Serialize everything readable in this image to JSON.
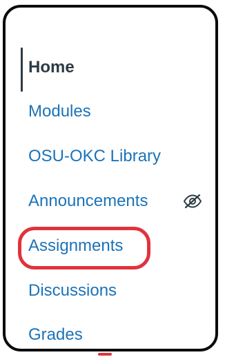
{
  "course_nav": {
    "items": [
      {
        "label": "Home",
        "active": true
      },
      {
        "label": "Modules",
        "active": false
      },
      {
        "label": "OSU-OKC Library",
        "active": false
      },
      {
        "label": "Announcements",
        "active": false,
        "icon": "eye-slash-icon",
        "hidden_from_students": true
      },
      {
        "label": "Assignments",
        "active": false,
        "highlighted": true
      },
      {
        "label": "Discussions",
        "active": false
      },
      {
        "label": "Grades",
        "active": false
      }
    ]
  },
  "colors": {
    "link": "#1b73b8",
    "active_text": "#2d3b45",
    "highlight": "#e0333c",
    "frame": "#0b0b0b"
  }
}
